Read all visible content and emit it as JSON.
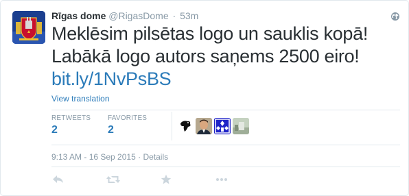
{
  "user": {
    "fullname": "Rīgas dome",
    "username": "@RigasDome",
    "separator": "·",
    "time_ago": "53m"
  },
  "tweet": {
    "line1": "Meklēsim pilsētas logo un sauklis kopā!",
    "line2": "Labākā logo autors saņems 2500 eiro!",
    "link": "bit.ly/1NvPsBS",
    "view_translation": "View translation"
  },
  "stats": {
    "retweets_label": "RETWEETS",
    "retweets_value": "2",
    "favorites_label": "FAVORITES",
    "favorites_value": "2"
  },
  "timestamp": {
    "datetime": "9:13 AM - 16 Sep 2015",
    "separator": "·",
    "details": "Details"
  },
  "icons": {
    "globe": "globe-icon",
    "reply": "reply-icon",
    "retweet": "retweet-icon",
    "favorite": "star-icon",
    "more": "more-icon"
  },
  "colors": {
    "link": "#2b7bb9",
    "muted": "#8899a6",
    "text": "#292f33",
    "divider": "#e1e8ed",
    "action_icon": "#ccd6dd"
  }
}
